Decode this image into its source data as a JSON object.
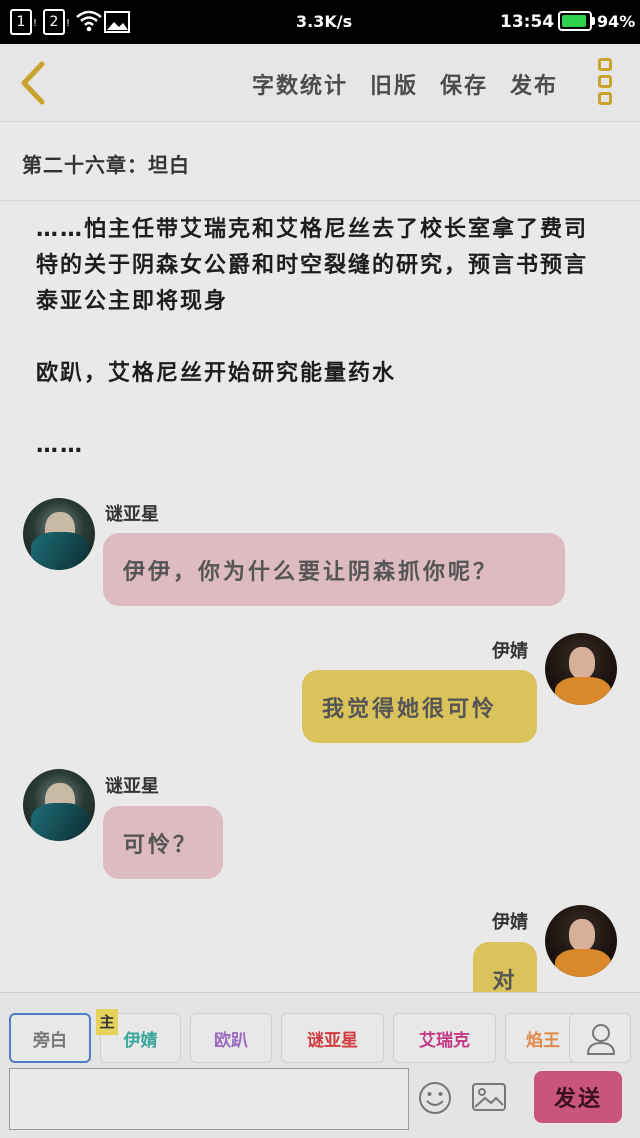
{
  "status_bar": {
    "sim1": "1",
    "sim2": "2",
    "speed": "3.3K/s",
    "time": "13:54",
    "battery": "94%",
    "battery_level": 0.94,
    "battery_color": "#2fd14a"
  },
  "toolbar": {
    "word_count": "字数统计",
    "old_version": "旧版",
    "save": "保存",
    "publish": "发布",
    "accent": "#c9a42c"
  },
  "chapter": {
    "title": "第二十六章：坦白"
  },
  "narration": [
    "……怕主任带艾瑞克和艾格尼丝去了校长室拿了费司特的关于阴森女公爵和时空裂缝的研究，预言书预言泰亚公主即将现身",
    "欧趴，艾格尼丝开始研究能量药水",
    "……"
  ],
  "messages": [
    {
      "speaker": "谜亚星",
      "text": "伊伊，你为什么要让阴森抓你呢？",
      "side": "left"
    },
    {
      "speaker": "伊婧",
      "text": "我觉得她很可怜",
      "side": "right"
    },
    {
      "speaker": "谜亚星",
      "text": "可怜？",
      "side": "left"
    },
    {
      "speaker": "伊婧",
      "text": "对",
      "side": "right"
    }
  ],
  "roles": {
    "narrator": "旁白",
    "main_badge": "主",
    "items": [
      {
        "label": "伊婧",
        "color": "#3aa79a"
      },
      {
        "label": "欧趴",
        "color": "#9a6bc0"
      },
      {
        "label": "谜亚星",
        "color": "#d23b3b"
      },
      {
        "label": "艾瑞克",
        "color": "#c23a86"
      },
      {
        "label": "焰王",
        "color": "#e08a4a"
      }
    ]
  },
  "composer": {
    "input_value": "",
    "send": "发送",
    "send_color": "#c9547c"
  },
  "icons": {
    "back": "chevron-left-icon",
    "more": "more-vertical-icon",
    "user": "user-icon",
    "emoji": "smiley-icon",
    "image": "image-icon"
  }
}
